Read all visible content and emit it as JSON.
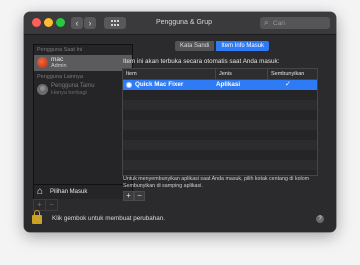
{
  "window": {
    "title": "Pengguna & Grup"
  },
  "search": {
    "placeholder": "Cari"
  },
  "sidebar": {
    "current_user_header": "Pengguna Saat Ini",
    "current_user": {
      "name": "mac",
      "role": "Admin"
    },
    "other_users_header": "Pengguna Lainnya",
    "guest_user": {
      "name": "Pengguna Tamu",
      "status": "Hanya berbagi"
    },
    "login_options_label": "Pilihan Masuk",
    "add_label": "+",
    "remove_label": "−"
  },
  "tabs": [
    {
      "label": "Kata Sandi",
      "active": false
    },
    {
      "label": "Item Info Masuk",
      "active": true
    }
  ],
  "main": {
    "description": "Item ini akan terbuka secara otomatis saat Anda masuk:",
    "table": {
      "columns": [
        "Item",
        "Jenis",
        "Sembunyikan"
      ],
      "rows": [
        {
          "name": "Quick Mac Fixer",
          "type": "Aplikasi",
          "hide": "✓"
        }
      ]
    },
    "note": "Untuk menyembunyikan aplikasi saat Anda masuk, pilih kotak centang di kolom Sembunyikan di samping aplikasi.",
    "add_label": "+",
    "remove_label": "−"
  },
  "footer": {
    "lock_text": "Klik gembok untuk membuat perubahan.",
    "help_label": "?"
  },
  "icons": {
    "back": "chevron-left-icon",
    "forward": "chevron-right-icon",
    "grid": "grid-icon",
    "search": "search-icon",
    "house": "house-icon",
    "lock": "lock-icon",
    "help": "help-icon"
  },
  "colors": {
    "accent": "#2f7bf5",
    "window_bg": "#2b2b2d",
    "lock": "#c9a227"
  }
}
